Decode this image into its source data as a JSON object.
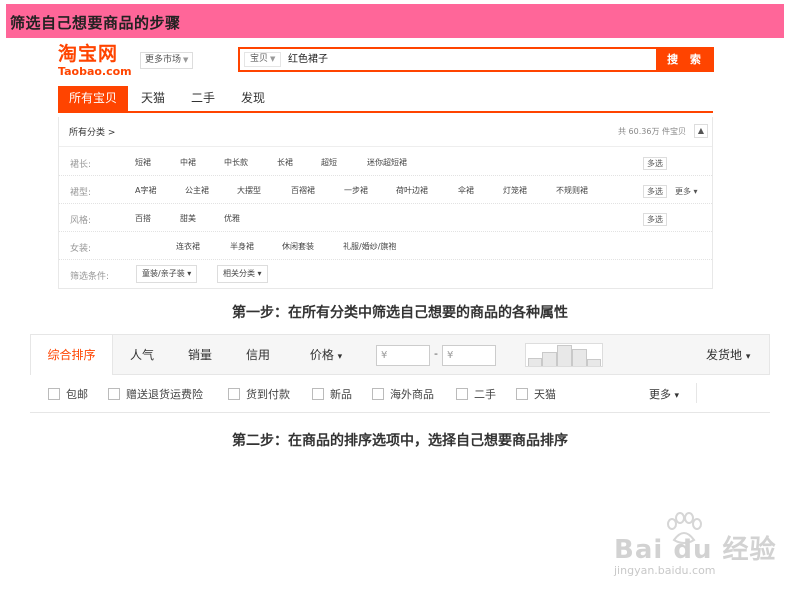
{
  "banner": {
    "title": "筛选自己想要商品的步骤"
  },
  "step1": {
    "logo": {
      "cn": "淘宝网",
      "en": "Taobao.com"
    },
    "market_button": "更多市场",
    "search": {
      "scope": "宝贝",
      "query": "红色裙子",
      "button": "搜 索"
    },
    "tabs": [
      "所有宝贝",
      "天猫",
      "二手",
      "发现"
    ],
    "active_tab": "所有宝贝",
    "filter": {
      "all_categories": "所有分类",
      "result_count": "共 60.36万 件宝贝",
      "rows": [
        {
          "label": "裙长:",
          "values": [
            "短裙",
            "中裙",
            "中长款",
            "长裙",
            "超短",
            "迷你超短裙"
          ],
          "multi": "多选"
        },
        {
          "label": "裙型:",
          "values": [
            "A字裙",
            "公主裙",
            "大摆型",
            "百褶裙",
            "一步裙",
            "荷叶边裙",
            "伞裙",
            "灯笼裙",
            "不规则裙"
          ],
          "multi": "多选",
          "more": "更多"
        },
        {
          "label": "风格:",
          "values": [
            "百搭",
            "甜美",
            "优雅"
          ],
          "multi": "多选"
        },
        {
          "label": "女装:",
          "values": [
            "连衣裙",
            "半身裙",
            "休闲套装",
            "礼服/婚纱/旗袍"
          ]
        }
      ],
      "conditions_label": "筛选条件:",
      "conditions": [
        "童装/亲子装",
        "相关分类"
      ]
    },
    "caption": "第一步：在所有分类中筛选自己想要的商品的各种属性"
  },
  "step2": {
    "sort_tabs": [
      "综合排序",
      "人气",
      "销量",
      "信用",
      "价格"
    ],
    "active_sort": "综合排序",
    "price_from": "¥",
    "price_to": "¥",
    "price_dash": "-",
    "ship_from": "发货地",
    "checks": [
      "包邮",
      "赠送退货运费险",
      "货到付款",
      "新品",
      "海外商品",
      "二手",
      "天猫"
    ],
    "more": "更多",
    "caption": "第二步：在商品的排序选项中，选择自己想要商品排序"
  },
  "watermark": {
    "logo": "Bai du 经验",
    "url": "jingyan.baidu.com"
  }
}
